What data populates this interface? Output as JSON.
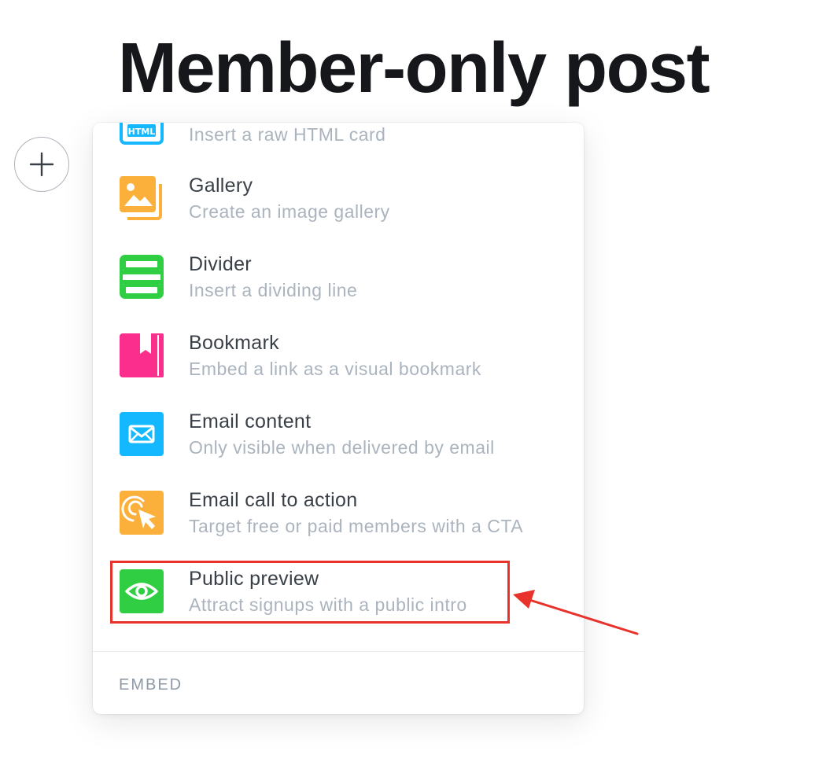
{
  "post": {
    "title": "Member-only post"
  },
  "editor": {
    "add_button_icon": "plus-icon"
  },
  "card_menu": {
    "items": [
      {
        "key": "html",
        "label": "",
        "description": "Insert a raw HTML card",
        "icon": "html-icon",
        "icon_text": "HTML",
        "color": "#14b8ff"
      },
      {
        "key": "gallery",
        "label": "Gallery",
        "description": "Create an image gallery",
        "icon": "gallery-icon",
        "color": "#fbb03b"
      },
      {
        "key": "divider",
        "label": "Divider",
        "description": "Insert a dividing line",
        "icon": "divider-icon",
        "color": "#30cf43"
      },
      {
        "key": "bookmark",
        "label": "Bookmark",
        "description": "Embed a link as a visual bookmark",
        "icon": "bookmark-icon",
        "color": "#fb2d8d"
      },
      {
        "key": "email",
        "label": "Email content",
        "description": "Only visible when delivered by email",
        "icon": "email-icon",
        "color": "#14b8ff"
      },
      {
        "key": "email-cta",
        "label": "Email call to action",
        "description": "Target free or paid members with a CTA",
        "icon": "cursor-click-icon",
        "color": "#fbb03b"
      },
      {
        "key": "public-preview",
        "label": "Public preview",
        "description": "Attract signups with a public intro",
        "icon": "eye-icon",
        "color": "#30cf43"
      }
    ],
    "section_label": "EMBED"
  },
  "annotation": {
    "highlight_color": "#e8322b",
    "highlight_target": "public-preview"
  }
}
